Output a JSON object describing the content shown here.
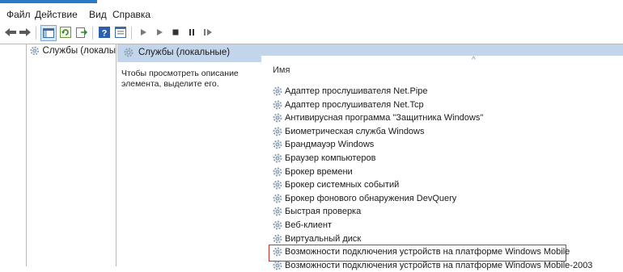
{
  "menu": {
    "file": "Файл",
    "action": "Действие",
    "view": "Вид",
    "help": "Справка"
  },
  "toolbar": {
    "icons": [
      "back-arrow-icon",
      "forward-arrow-icon",
      "console-tree-icon",
      "refresh-icon",
      "export-icon",
      "help-icon",
      "properties-icon",
      "play-icon",
      "play-alt-icon",
      "stop-icon",
      "pause-icon",
      "resume-icon"
    ]
  },
  "tree": {
    "item_label": "Службы (локалы"
  },
  "pane": {
    "title": "Службы (локальные)",
    "description": "Чтобы просмотреть описание элемента, выделите его.",
    "column_name": "Имя",
    "sort_caret": "^"
  },
  "services": [
    "Адаптер прослушивателя Net.Pipe",
    "Адаптер прослушивателя Net.Tcp",
    "Антивирусная программа \"Защитника Windows\"",
    "Биометрическая служба Windows",
    "Брандмауэр Windows",
    "Браузер компьютеров",
    "Брокер времени",
    "Брокер системных событий",
    "Брокер фонового обнаружения DevQuery",
    "Быстрая проверка",
    "Веб-клиент",
    "Виртуальный диск",
    "Возможности подключения устройств на платформе Windows Mobile",
    "Возможности подключения устройств на платформе Windows Mobile-2003"
  ],
  "highlighted_service_index": 12,
  "colors": {
    "header_bg": "#c2d5ea",
    "highlight_border": "#d9302b"
  }
}
